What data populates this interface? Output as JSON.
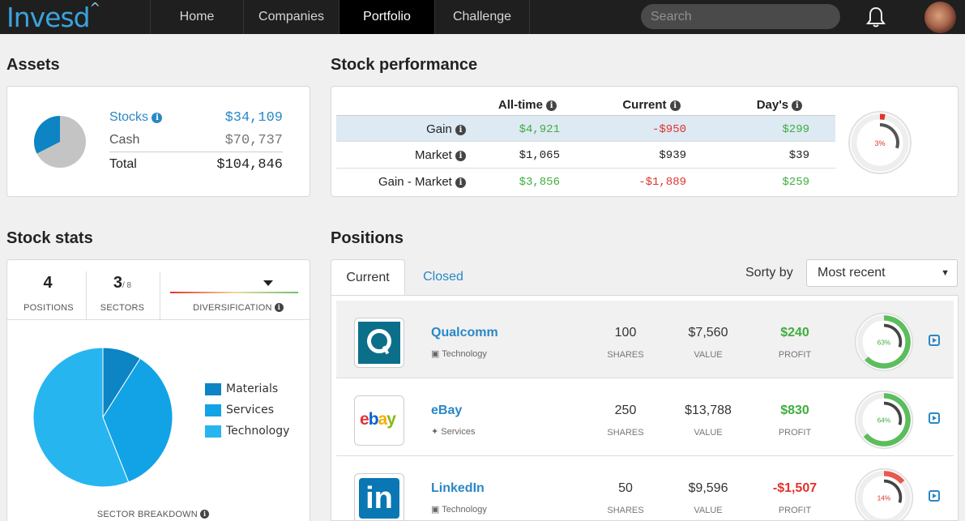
{
  "nav": {
    "logo": "Invesd",
    "tabs": [
      "Home",
      "Companies",
      "Portfolio",
      "Challenge"
    ],
    "active_tab": "Portfolio",
    "search_placeholder": "Search"
  },
  "assets": {
    "title": "Assets",
    "stocks_label": "Stocks",
    "stocks_value": "$34,109",
    "cash_label": "Cash",
    "cash_value": "$70,737",
    "total_label": "Total",
    "total_value": "$104,846",
    "stocks_fraction": 0.325
  },
  "performance": {
    "title": "Stock performance",
    "columns": [
      "All-time",
      "Current",
      "Day's"
    ],
    "rows": [
      {
        "label": "Gain",
        "values": [
          "$4,921",
          "-$950",
          "$299"
        ]
      },
      {
        "label": "Market",
        "values": [
          "$1,065",
          "$939",
          "$39"
        ]
      },
      {
        "label": "Gain - Market",
        "values": [
          "$3,856",
          "-$1,889",
          "$259"
        ]
      }
    ],
    "gauge_label": "3%",
    "gauge_fraction": 0.03
  },
  "stats": {
    "title": "Stock stats",
    "positions_count": "4",
    "positions_label": "POSITIONS",
    "sectors_count": "3",
    "sectors_total": "/ 8",
    "sectors_label": "SECTORS",
    "diversification_label": "DIVERSIFICATION",
    "sector_breakdown_label": "SECTOR BREAKDOWN",
    "legend": [
      {
        "name": "Materials",
        "color": "#0d84c4"
      },
      {
        "name": "Services",
        "color": "#11a3e6"
      },
      {
        "name": "Technology",
        "color": "#27b5ef"
      }
    ],
    "sector_fractions": [
      0.09,
      0.35,
      0.56
    ]
  },
  "positions": {
    "title": "Positions",
    "tabs": [
      "Current",
      "Closed"
    ],
    "sort_label": "Sorty by",
    "sort_value": "Most recent",
    "shares_label": "SHARES",
    "value_label": "VALUE",
    "profit_label": "PROFIT",
    "items": [
      {
        "name": "Qualcomm",
        "sector": "Technology",
        "shares": "100",
        "value": "$7,560",
        "profit": "$240",
        "gauge_label": "63%",
        "gauge_fraction": 0.63,
        "logo": "Q"
      },
      {
        "name": "eBay",
        "sector": "Services",
        "shares": "250",
        "value": "$13,788",
        "profit": "$830",
        "gauge_label": "64%",
        "gauge_fraction": 0.64,
        "logo": "ebay"
      },
      {
        "name": "LinkedIn",
        "sector": "Technology",
        "shares": "50",
        "value": "$9,596",
        "profit": "-$1,507",
        "gauge_label": "14%",
        "gauge_fraction": 0.14,
        "logo": "in"
      }
    ]
  }
}
